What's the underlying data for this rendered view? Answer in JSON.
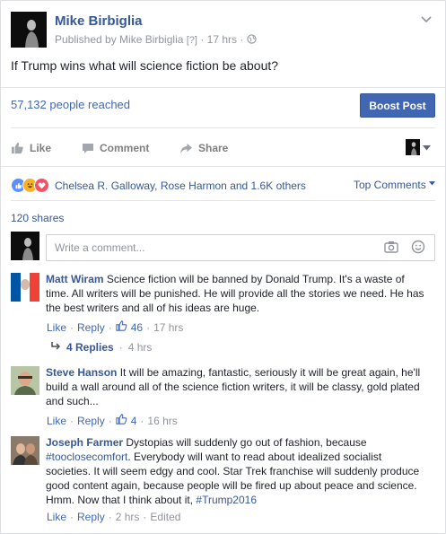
{
  "post": {
    "author": "Mike Birbiglia",
    "published_by": "Published by Mike Birbiglia",
    "bracket": "[?]",
    "time": "17 hrs",
    "text": "If Trump wins what will science fiction be about?",
    "reached": "57,132 people reached",
    "boost_label": "Boost Post"
  },
  "actions": {
    "like": "Like",
    "comment": "Comment",
    "share": "Share"
  },
  "reactions": {
    "summary": "Chelsea R. Galloway, Rose Harmon and 1.6K others",
    "sort": "Top Comments"
  },
  "shares": "120 shares",
  "comment_box": {
    "placeholder": "Write a comment..."
  },
  "comments": [
    {
      "name": "Matt Wiram",
      "text": "Science fiction will be banned by Donald Trump. It's a waste of time. All writers will be punished. He will provide all the stories we need. He has the best writers and all of his ideas are huge.",
      "like": "Like",
      "reply": "Reply",
      "likes": "46",
      "time": "17 hrs",
      "replies": "4 Replies",
      "replies_time": "4 hrs"
    },
    {
      "name": "Steve Hanson",
      "text": "It will be amazing, fantastic, seriously it will be great again, he'll build a wall around all of the science fiction writers, it will be classy, gold plated and such...",
      "like": "Like",
      "reply": "Reply",
      "likes": "4",
      "time": "16 hrs"
    },
    {
      "name": "Joseph Farmer",
      "text_a": "Dystopias will suddenly go out of fashion, because",
      "hashtag_a": "#tooclosecomfort",
      "text_b": ". Everybody will want to read about idealized socialist societies. It will seem edgy and cool. Star Trek franchise will suddenly produce good content again, because people will be fired up about peace and science. Hmm. Now that I think about it,",
      "hashtag_b": "#Trump2016",
      "like": "Like",
      "reply": "Reply",
      "time": "2 hrs",
      "edited": "Edited"
    }
  ],
  "colors": {
    "brand_blue": "#4267b2",
    "name_blue": "#365899",
    "meta_gray": "#90949c"
  }
}
